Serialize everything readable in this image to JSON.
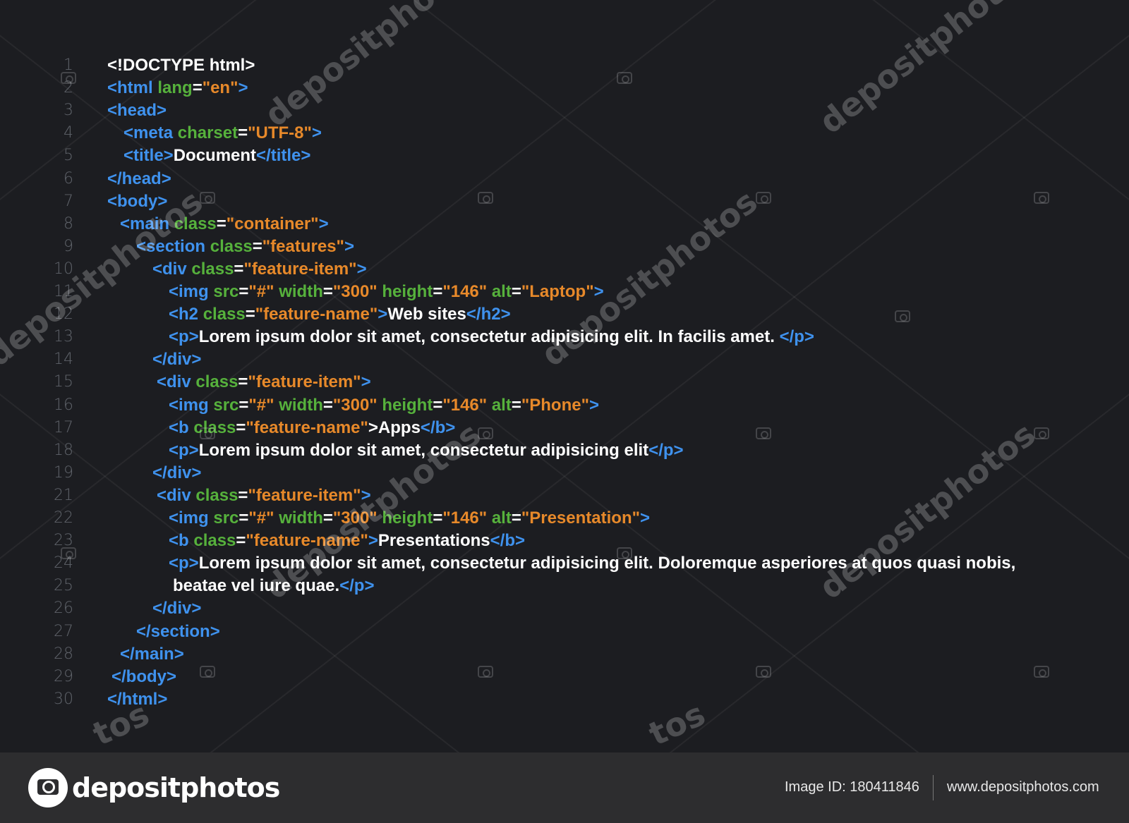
{
  "colors": {
    "background": "#1c1d21",
    "tag": "#3f92ee",
    "attribute": "#56b13c",
    "value": "#e7892a",
    "text": "#ffffff",
    "line_number": "#5f636a",
    "footer": "#2d2d2f"
  },
  "code": {
    "lines": [
      {
        "n": "1",
        "segments": [
          {
            "s": "w",
            "t": "<!DOCTYPE html>"
          }
        ]
      },
      {
        "n": "2",
        "segments": [
          {
            "s": "t",
            "t": "<html "
          },
          {
            "s": "a",
            "t": "lang"
          },
          {
            "s": "w",
            "t": "="
          },
          {
            "s": "v",
            "t": "\"en\""
          },
          {
            "s": "t",
            "t": ">"
          }
        ]
      },
      {
        "n": "3",
        "segments": [
          {
            "s": "t",
            "t": "<head>"
          }
        ]
      },
      {
        "n": "4",
        "segments": [
          {
            "s": "t",
            "t": "<meta "
          },
          {
            "s": "a",
            "t": "charset"
          },
          {
            "s": "w",
            "t": "="
          },
          {
            "s": "v",
            "t": "\"UTF-8\""
          },
          {
            "s": "t",
            "t": ">"
          }
        ]
      },
      {
        "n": "5",
        "segments": [
          {
            "s": "t",
            "t": "<title>"
          },
          {
            "s": "w",
            "t": "Document"
          },
          {
            "s": "t",
            "t": "</title>"
          }
        ]
      },
      {
        "n": "6",
        "segments": [
          {
            "s": "t",
            "t": "</head>"
          }
        ]
      },
      {
        "n": "7",
        "segments": [
          {
            "s": "t",
            "t": "<body>"
          }
        ]
      },
      {
        "n": "8",
        "segments": [
          {
            "s": "t",
            "t": "<main "
          },
          {
            "s": "a",
            "t": "class"
          },
          {
            "s": "w",
            "t": "="
          },
          {
            "s": "v",
            "t": "\"container\""
          },
          {
            "s": "t",
            "t": ">"
          }
        ]
      },
      {
        "n": "9",
        "segments": [
          {
            "s": "t",
            "t": "<section "
          },
          {
            "s": "a",
            "t": "class"
          },
          {
            "s": "w",
            "t": "="
          },
          {
            "s": "v",
            "t": "\"features\""
          },
          {
            "s": "t",
            "t": ">"
          }
        ]
      },
      {
        "n": "10",
        "segments": [
          {
            "s": "t",
            "t": "<div "
          },
          {
            "s": "a",
            "t": "class"
          },
          {
            "s": "w",
            "t": "="
          },
          {
            "s": "v",
            "t": "\"feature-item\""
          },
          {
            "s": "t",
            "t": ">"
          }
        ]
      },
      {
        "n": "11",
        "segments": [
          {
            "s": "t",
            "t": "<img "
          },
          {
            "s": "a",
            "t": "src"
          },
          {
            "s": "w",
            "t": "="
          },
          {
            "s": "v",
            "t": "\"#\" "
          },
          {
            "s": "a",
            "t": "width"
          },
          {
            "s": "w",
            "t": "="
          },
          {
            "s": "v",
            "t": "\"300\" "
          },
          {
            "s": "a",
            "t": "height"
          },
          {
            "s": "w",
            "t": "="
          },
          {
            "s": "v",
            "t": "\"146\" "
          },
          {
            "s": "a",
            "t": "alt"
          },
          {
            "s": "w",
            "t": "="
          },
          {
            "s": "v",
            "t": "\"Laptop\""
          },
          {
            "s": "t",
            "t": ">"
          }
        ]
      },
      {
        "n": "12",
        "segments": [
          {
            "s": "t",
            "t": "<h2 "
          },
          {
            "s": "a",
            "t": "class"
          },
          {
            "s": "w",
            "t": "="
          },
          {
            "s": "v",
            "t": "\"feature-name\""
          },
          {
            "s": "t",
            "t": ">"
          },
          {
            "s": "w",
            "t": "Web sites"
          },
          {
            "s": "t",
            "t": "</h2>"
          }
        ]
      },
      {
        "n": "13",
        "segments": [
          {
            "s": "t",
            "t": "<p>"
          },
          {
            "s": "w",
            "t": "Lorem ipsum dolor sit amet, consectetur adipisicing elit. In facilis amet. "
          },
          {
            "s": "t",
            "t": "</p>"
          }
        ]
      },
      {
        "n": "14",
        "segments": [
          {
            "s": "t",
            "t": "</div>"
          }
        ]
      },
      {
        "n": "15",
        "segments": [
          {
            "s": "t",
            "t": "<div "
          },
          {
            "s": "a",
            "t": "class"
          },
          {
            "s": "w",
            "t": "="
          },
          {
            "s": "v",
            "t": "\"feature-item\""
          },
          {
            "s": "t",
            "t": ">"
          }
        ]
      },
      {
        "n": "16",
        "segments": [
          {
            "s": "t",
            "t": "<img "
          },
          {
            "s": "a",
            "t": "src"
          },
          {
            "s": "w",
            "t": "="
          },
          {
            "s": "v",
            "t": "\"#\" "
          },
          {
            "s": "a",
            "t": "width"
          },
          {
            "s": "w",
            "t": "="
          },
          {
            "s": "v",
            "t": "\"300\" "
          },
          {
            "s": "a",
            "t": "height"
          },
          {
            "s": "w",
            "t": "="
          },
          {
            "s": "v",
            "t": "\"146\" "
          },
          {
            "s": "a",
            "t": "alt"
          },
          {
            "s": "w",
            "t": "="
          },
          {
            "s": "v",
            "t": "\"Phone\""
          },
          {
            "s": "t",
            "t": ">"
          }
        ]
      },
      {
        "n": "17",
        "segments": [
          {
            "s": "t",
            "t": "<b "
          },
          {
            "s": "a",
            "t": "class"
          },
          {
            "s": "w",
            "t": "="
          },
          {
            "s": "v",
            "t": "\"feature-name\""
          },
          {
            "s": "w",
            "t": ">Apps"
          },
          {
            "s": "t",
            "t": "</b>"
          }
        ]
      },
      {
        "n": "18",
        "segments": [
          {
            "s": "t",
            "t": "<p>"
          },
          {
            "s": "w",
            "t": "Lorem ipsum dolor sit amet, consectetur adipisicing elit"
          },
          {
            "s": "t",
            "t": "</p>"
          }
        ]
      },
      {
        "n": "19",
        "segments": [
          {
            "s": "t",
            "t": "</div>"
          }
        ]
      },
      {
        "n": "21",
        "segments": [
          {
            "s": "t",
            "t": "<div "
          },
          {
            "s": "a",
            "t": "class"
          },
          {
            "s": "w",
            "t": "="
          },
          {
            "s": "v",
            "t": "\"feature-item\""
          },
          {
            "s": "t",
            "t": ">"
          }
        ]
      },
      {
        "n": "22",
        "segments": [
          {
            "s": "t",
            "t": "<img "
          },
          {
            "s": "a",
            "t": "src"
          },
          {
            "s": "w",
            "t": "="
          },
          {
            "s": "v",
            "t": "\"#\" "
          },
          {
            "s": "a",
            "t": "width"
          },
          {
            "s": "w",
            "t": "="
          },
          {
            "s": "v",
            "t": "\"300\" "
          },
          {
            "s": "a",
            "t": "height"
          },
          {
            "s": "w",
            "t": "="
          },
          {
            "s": "v",
            "t": "\"146\" "
          },
          {
            "s": "a",
            "t": "alt"
          },
          {
            "s": "w",
            "t": "="
          },
          {
            "s": "v",
            "t": "\"Presentation\""
          },
          {
            "s": "t",
            "t": ">"
          }
        ]
      },
      {
        "n": "23",
        "segments": [
          {
            "s": "t",
            "t": "<b "
          },
          {
            "s": "a",
            "t": "class"
          },
          {
            "s": "w",
            "t": "="
          },
          {
            "s": "v",
            "t": "\"feature-name\""
          },
          {
            "s": "t",
            "t": ">"
          },
          {
            "s": "w",
            "t": "Presentations"
          },
          {
            "s": "t",
            "t": "</b>"
          }
        ]
      },
      {
        "n": "24",
        "segments": [
          {
            "s": "t",
            "t": "<p>"
          },
          {
            "s": "w",
            "t": "Lorem ipsum dolor sit amet, consectetur adipisicing elit. Doloremque asperiores at quos quasi nobis,"
          }
        ]
      },
      {
        "n": "25",
        "segments": [
          {
            "s": "w",
            "t": "beatae vel iure quae."
          },
          {
            "s": "t",
            "t": "</p>"
          }
        ]
      },
      {
        "n": "26",
        "segments": [
          {
            "s": "t",
            "t": "</div>"
          }
        ]
      },
      {
        "n": "27",
        "segments": [
          {
            "s": "t",
            "t": "</section>"
          }
        ]
      },
      {
        "n": "28",
        "segments": [
          {
            "s": "t",
            "t": "</main>"
          }
        ]
      },
      {
        "n": "29",
        "segments": [
          {
            "s": "t",
            "t": "</body>"
          }
        ]
      },
      {
        "n": "30",
        "segments": [
          {
            "s": "t",
            "t": "</html>"
          }
        ]
      }
    ]
  },
  "watermark": {
    "text": "depositphotos",
    "partial": "tos"
  },
  "footer": {
    "logo_text": "depositphotos",
    "image_id": "Image ID: 180411846",
    "site": "www.depositphotos.com"
  }
}
